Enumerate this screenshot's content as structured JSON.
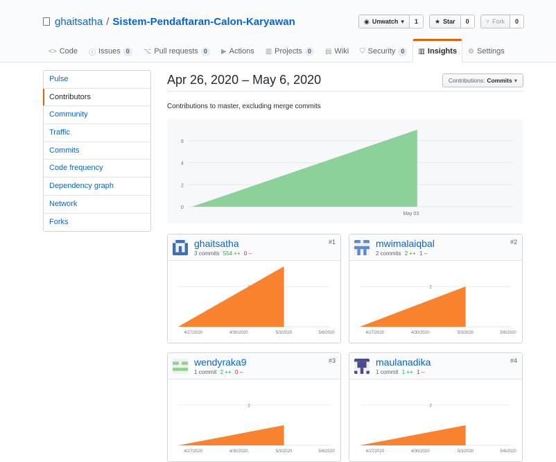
{
  "repo": {
    "owner": "ghaitsatha",
    "separator": "/",
    "name": "Sistem-Pendaftaran-Calon-Karyawan"
  },
  "actions": {
    "watch_label": "Unwatch",
    "watch_count": "1",
    "star_label": "Star",
    "star_count": "0",
    "fork_label": "Fork",
    "fork_count": "0"
  },
  "nav": {
    "code": "Code",
    "issues": "Issues",
    "issues_count": "0",
    "pulls": "Pull requests",
    "pulls_count": "0",
    "actions": "Actions",
    "projects": "Projects",
    "projects_count": "0",
    "wiki": "Wiki",
    "security": "Security",
    "security_count": "0",
    "insights": "Insights",
    "settings": "Settings"
  },
  "sidebar": {
    "items": [
      {
        "label": "Pulse"
      },
      {
        "label": "Contributors"
      },
      {
        "label": "Community"
      },
      {
        "label": "Traffic"
      },
      {
        "label": "Commits"
      },
      {
        "label": "Code frequency"
      },
      {
        "label": "Dependency graph"
      },
      {
        "label": "Network"
      },
      {
        "label": "Forks"
      }
    ]
  },
  "main": {
    "heading": "Apr 26, 2020 – May 6, 2020",
    "select_prefix": "Contributions:",
    "select_value": "Commits",
    "subtitle": "Contributions to master, excluding merge commits"
  },
  "chart_data": [
    {
      "type": "area",
      "color": "#8cd19a",
      "x": [
        "2020-04-26",
        "2020-05-03"
      ],
      "y": [
        0,
        7
      ],
      "xticks": [
        "May 03"
      ],
      "yticks": [
        "0",
        "2",
        "4",
        "6"
      ],
      "ylim": [
        0,
        7
      ]
    },
    {
      "type": "area",
      "color": "#f9822f",
      "contributor": "ghaitsatha",
      "x": [
        "2020-04-26",
        "2020-05-03"
      ],
      "y": [
        0,
        3
      ],
      "xticks": [
        "4/27/2020",
        "4/30/2020",
        "5/3/2020",
        "5/6/2020"
      ],
      "yticks": [
        "2"
      ],
      "ylim": [
        0,
        3
      ]
    },
    {
      "type": "area",
      "color": "#f9822f",
      "contributor": "mwimalaiqbal",
      "x": [
        "2020-04-26",
        "2020-05-03"
      ],
      "y": [
        0,
        2
      ],
      "xticks": [
        "4/27/2020",
        "4/30/2020",
        "5/3/2020",
        "5/6/2020"
      ],
      "yticks": [
        "2"
      ],
      "ylim": [
        0,
        3
      ]
    },
    {
      "type": "area",
      "color": "#f9822f",
      "contributor": "wendyraka9",
      "x": [
        "2020-04-26",
        "2020-05-03"
      ],
      "y": [
        0,
        1
      ],
      "xticks": [
        "4/27/2020",
        "4/30/2020",
        "5/3/2020",
        "5/6/2020"
      ],
      "yticks": [
        "2"
      ],
      "ylim": [
        0,
        3
      ]
    },
    {
      "type": "area",
      "color": "#f9822f",
      "contributor": "maulanadika",
      "x": [
        "2020-04-26",
        "2020-05-03"
      ],
      "y": [
        0,
        1
      ],
      "xticks": [
        "4/27/2020",
        "4/30/2020",
        "5/3/2020",
        "5/6/2020"
      ],
      "yticks": [
        "2"
      ],
      "ylim": [
        0,
        3
      ]
    }
  ],
  "contributors": [
    {
      "name": "ghaitsatha",
      "commits": "3 commits",
      "additions": "554 ++",
      "deletions": "0 --",
      "rank": "#1"
    },
    {
      "name": "mwimalaiqbal",
      "commits": "2 commits",
      "additions": "2 ++",
      "deletions": "1 --",
      "rank": "#2"
    },
    {
      "name": "wendyraka9",
      "commits": "1 commit",
      "additions": "2 ++",
      "deletions": "0 --",
      "rank": "#3"
    },
    {
      "name": "maulanadika",
      "commits": "1 commit",
      "additions": "1 ++",
      "deletions": "1 --",
      "rank": "#4"
    }
  ]
}
